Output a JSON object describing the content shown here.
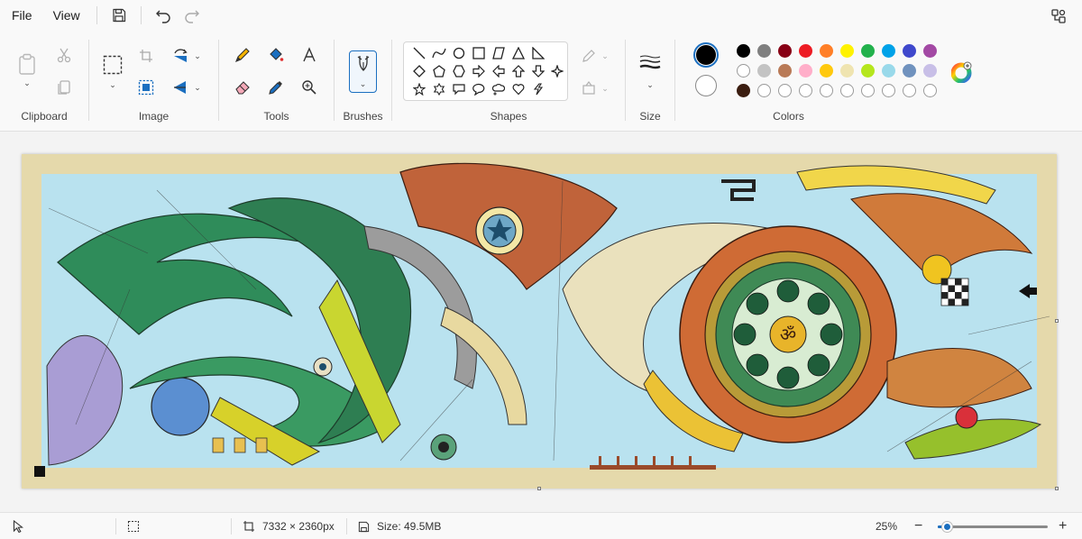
{
  "menu": {
    "file": "File",
    "view": "View"
  },
  "ribbon": {
    "groups": {
      "clipboard": "Clipboard",
      "image": "Image",
      "tools": "Tools",
      "brushes": "Brushes",
      "shapes": "Shapes",
      "size": "Size",
      "colors": "Colors"
    }
  },
  "colors": {
    "primary": "#000000",
    "secondary": "#ffffff",
    "palette_row1": [
      "#000000",
      "#7f7f7f",
      "#880015",
      "#ed1c24",
      "#ff7f27",
      "#fff200",
      "#22b14c",
      "#00a2e8",
      "#3f48cc",
      "#a349a4"
    ],
    "palette_row2": [
      "#ffffff",
      "#c3c3c3",
      "#b97a57",
      "#ffaec9",
      "#ffc90e",
      "#efe4b0",
      "#b5e61d",
      "#99d9ea",
      "#7092be",
      "#c8bfe7"
    ],
    "palette_row3": [
      "#3b1d10"
    ]
  },
  "status": {
    "dimensions": "7332 × 2360px",
    "size": "Size: 49.5MB",
    "zoom": "25%",
    "zoom_level": 0.08
  }
}
